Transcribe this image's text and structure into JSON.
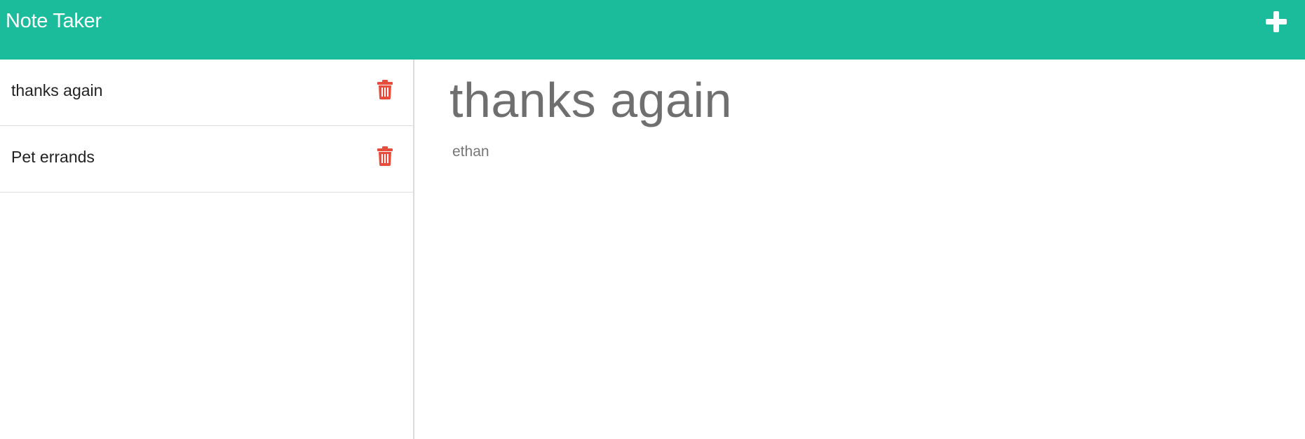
{
  "navbar": {
    "brand": "Note Taker",
    "new_note_icon": "plus-icon",
    "background_color": "#1abc9c"
  },
  "sidebar": {
    "notes": [
      {
        "title": "thanks again",
        "delete_icon": "trash-icon"
      },
      {
        "title": "Pet errands",
        "delete_icon": "trash-icon"
      }
    ],
    "delete_color": "#e74c3c"
  },
  "editor": {
    "title": "thanks again",
    "text": "ethan"
  }
}
